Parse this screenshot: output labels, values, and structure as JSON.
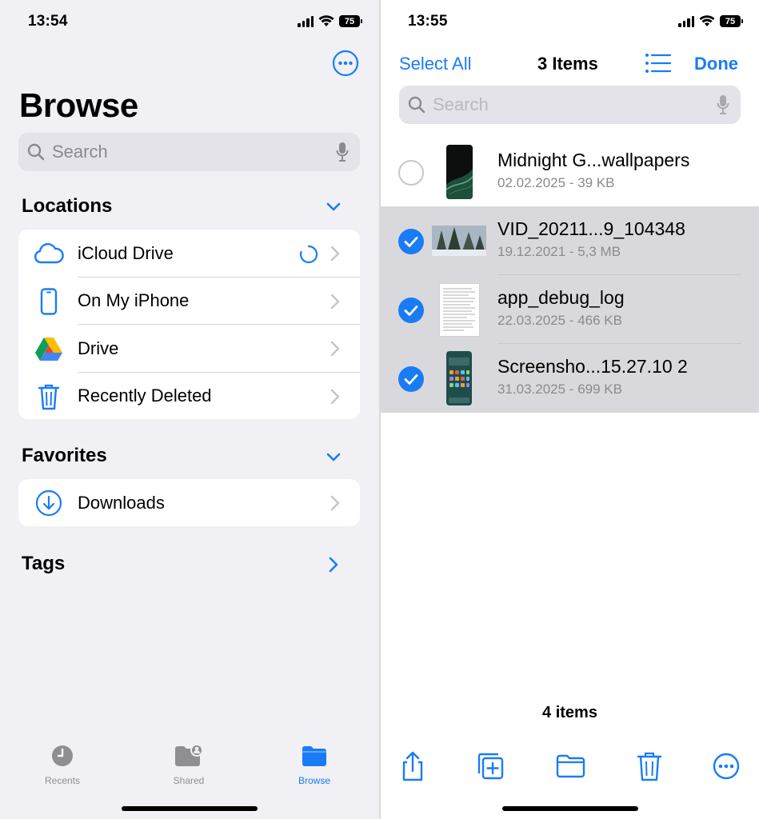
{
  "left": {
    "status": {
      "time": "13:54",
      "battery": "75"
    },
    "title": "Browse",
    "search_placeholder": "Search",
    "locations": {
      "title": "Locations",
      "items": [
        {
          "label": "iCloud Drive",
          "icon": "cloud-icon"
        },
        {
          "label": "On My iPhone",
          "icon": "iphone-icon"
        },
        {
          "label": "Drive",
          "icon": "google-drive-icon"
        },
        {
          "label": "Recently Deleted",
          "icon": "trash-icon"
        }
      ]
    },
    "favorites": {
      "title": "Favorites",
      "items": [
        {
          "label": "Downloads",
          "icon": "download-circle-icon"
        }
      ]
    },
    "tags_title": "Tags",
    "tabs": [
      {
        "label": "Recents",
        "icon": "clock-icon",
        "active": false
      },
      {
        "label": "Shared",
        "icon": "shared-folder-icon",
        "active": false
      },
      {
        "label": "Browse",
        "icon": "folder-icon",
        "active": true
      }
    ]
  },
  "right": {
    "status": {
      "time": "13:55",
      "battery": "75"
    },
    "select_all": "Select All",
    "title": "3 Items",
    "done": "Done",
    "search_placeholder": "Search",
    "files": [
      {
        "name": "Midnight G...wallpapers",
        "meta": "02.02.2025 - 39 KB",
        "selected": false
      },
      {
        "name": "VID_20211...9_104348",
        "meta": "19.12.2021 - 5,3 MB",
        "selected": true
      },
      {
        "name": "app_debug_log",
        "meta": "22.03.2025 - 466 KB",
        "selected": true
      },
      {
        "name": "Screensho...15.27.10 2",
        "meta": "31.03.2025 - 699 KB",
        "selected": true
      }
    ],
    "count": "4 items",
    "toolbar": [
      "share-icon",
      "duplicate-icon",
      "move-folder-icon",
      "trash-icon",
      "more-icon"
    ]
  },
  "colors": {
    "accent": "#1a7cf4",
    "background_left": "#f0f0f5",
    "selected_row": "#d9d9dd"
  }
}
